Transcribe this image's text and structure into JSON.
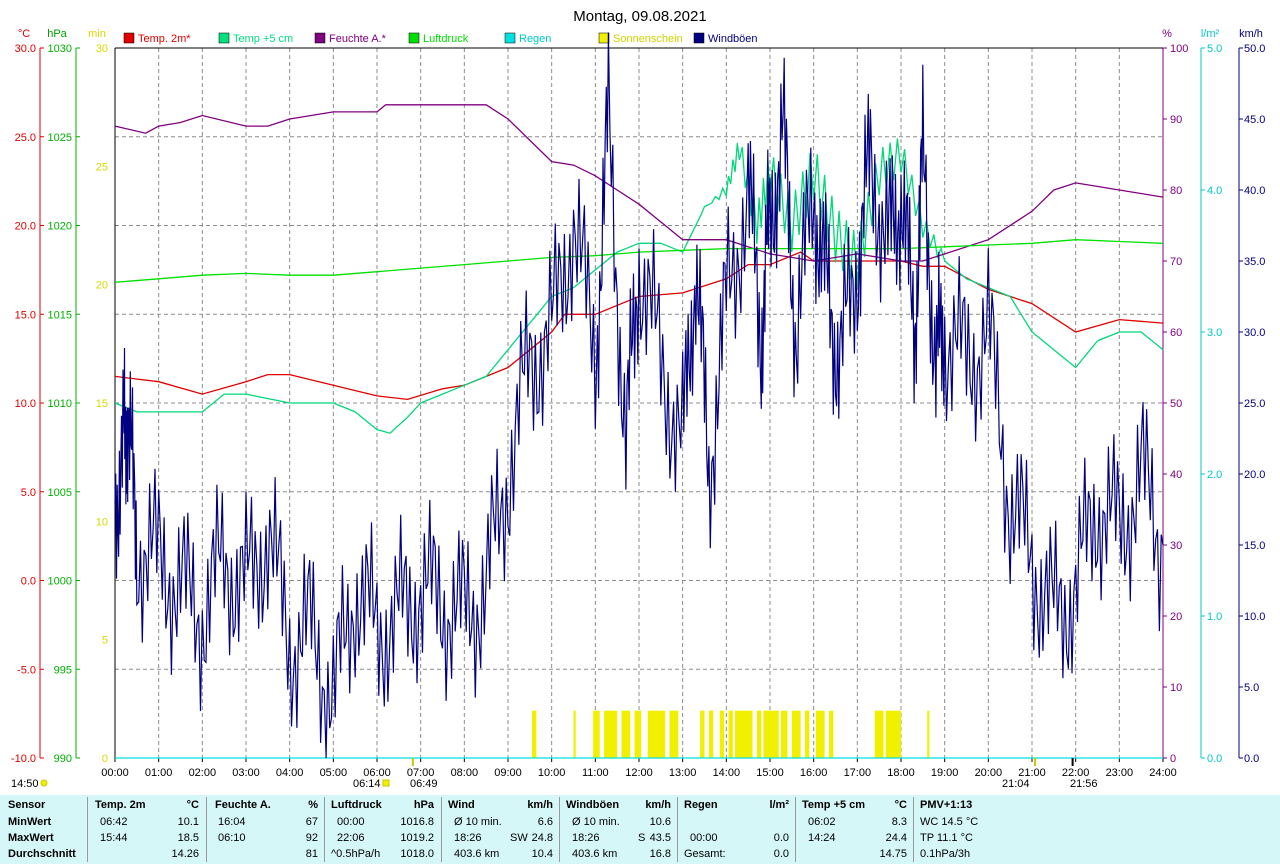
{
  "title": "Montag, 09.08.2021",
  "axes": {
    "temp": {
      "unit": "°C",
      "ticks": [
        "30.0",
        "25.0",
        "20.0",
        "15.0",
        "10.0",
        "5.0",
        "0.0",
        "-5.0",
        "-10.0"
      ]
    },
    "pressure": {
      "unit": "hPa",
      "ticks": [
        "1030",
        "1025",
        "1020",
        "1015",
        "1010",
        "1005",
        "1000",
        "995",
        "990"
      ]
    },
    "sunshine": {
      "unit": "min",
      "ticks": [
        "30",
        "25",
        "20",
        "15",
        "10",
        "5",
        "0"
      ]
    },
    "humidity": {
      "unit": "%",
      "ticks": [
        "100",
        "90",
        "80",
        "70",
        "60",
        "50",
        "40",
        "30",
        "20",
        "10",
        "0"
      ]
    },
    "rain": {
      "unit": "l/m²",
      "ticks": [
        "5.0",
        "4.0",
        "3.0",
        "2.0",
        "1.0",
        "0.0"
      ]
    },
    "wind": {
      "unit": "km/h",
      "ticks": [
        "50.0",
        "45.0",
        "40.0",
        "35.0",
        "30.0",
        "25.0",
        "20.0",
        "15.0",
        "10.0",
        "5.0",
        "0.0"
      ]
    },
    "time_ticks": [
      "00:00",
      "01:00",
      "02:00",
      "03:00",
      "04:00",
      "05:00",
      "06:00",
      "07:00",
      "08:00",
      "09:00",
      "10:00",
      "11:00",
      "12:00",
      "13:00",
      "14:00",
      "15:00",
      "16:00",
      "17:00",
      "18:00",
      "19:00",
      "20:00",
      "21:00",
      "22:00",
      "23:00",
      "24:00"
    ]
  },
  "legend": [
    {
      "label": "Temp. 2m*",
      "color": "#e00000"
    },
    {
      "label": "Temp +5 cm",
      "color": "#00e080"
    },
    {
      "label": "Feuchte A.*",
      "color": "#800080"
    },
    {
      "label": "Luftdruck",
      "color": "#00e000"
    },
    {
      "label": "Regen",
      "color": "#00e0e0"
    },
    {
      "label": "Sonnenschein",
      "color": "#f0f000"
    },
    {
      "label": "Windböen",
      "color": "#000080"
    }
  ],
  "markers": {
    "corner": "14:50",
    "sunrise": "06:14",
    "sunrise_civil": "06:49",
    "sunset_civil": "21:04",
    "sunset": "21:56"
  },
  "chart_data": {
    "type": "line",
    "title": "Montag, 09.08.2021",
    "x_range": [
      "00:00",
      "24:00"
    ],
    "series": [
      {
        "name": "Temp. 2m*",
        "axis": "°C",
        "ylim": [
          -10,
          30
        ],
        "points": [
          [
            0,
            11.5
          ],
          [
            1,
            11.2
          ],
          [
            2,
            10.5
          ],
          [
            3,
            11.2
          ],
          [
            3.5,
            11.6
          ],
          [
            4,
            11.6
          ],
          [
            5,
            11.0
          ],
          [
            6,
            10.4
          ],
          [
            6.7,
            10.2
          ],
          [
            7.5,
            10.8
          ],
          [
            8,
            11.0
          ],
          [
            9,
            12.0
          ],
          [
            10,
            14.0
          ],
          [
            10.3,
            15.0
          ],
          [
            11,
            15.0
          ],
          [
            12,
            16.0
          ],
          [
            13,
            16.2
          ],
          [
            14,
            17.0
          ],
          [
            14.5,
            17.8
          ],
          [
            15,
            17.8
          ],
          [
            15.7,
            18.5
          ],
          [
            16,
            18.0
          ],
          [
            17,
            18.0
          ],
          [
            18,
            18.0
          ],
          [
            18.5,
            17.7
          ],
          [
            19,
            17.7
          ],
          [
            20,
            16.4
          ],
          [
            21,
            15.6
          ],
          [
            22,
            14.0
          ],
          [
            23,
            14.7
          ],
          [
            24,
            14.5
          ]
        ]
      },
      {
        "name": "Temp +5 cm",
        "axis": "°C",
        "ylim": [
          -10,
          30
        ],
        "points": [
          [
            0,
            10.0
          ],
          [
            0.5,
            9.5
          ],
          [
            1,
            9.5
          ],
          [
            2,
            9.5
          ],
          [
            2.5,
            10.5
          ],
          [
            3,
            10.5
          ],
          [
            4,
            10.0
          ],
          [
            4.5,
            10.0
          ],
          [
            5,
            10.0
          ],
          [
            5.5,
            9.5
          ],
          [
            6,
            8.5
          ],
          [
            6.3,
            8.3
          ],
          [
            6.7,
            9.2
          ],
          [
            7,
            10.0
          ],
          [
            8,
            11.0
          ],
          [
            8.5,
            11.5
          ],
          [
            9,
            13.0
          ],
          [
            9.5,
            14.5
          ],
          [
            10,
            16.0
          ],
          [
            10.5,
            16.5
          ],
          [
            11,
            17.5
          ],
          [
            11.5,
            18.5
          ],
          [
            12,
            19.0
          ],
          [
            12.5,
            19.0
          ],
          [
            13,
            18.5
          ],
          [
            13.5,
            21.0
          ],
          [
            14,
            22.0
          ],
          [
            14.3,
            24.4
          ],
          [
            14.7,
            20.0
          ],
          [
            15,
            23.0
          ],
          [
            15.5,
            20.0
          ],
          [
            16,
            23.0
          ],
          [
            16.5,
            19.5
          ],
          [
            17,
            18.0
          ],
          [
            17.5,
            23.0
          ],
          [
            18,
            24.0
          ],
          [
            18.5,
            20.0
          ],
          [
            19,
            18.0
          ],
          [
            19.5,
            17.0
          ],
          [
            20,
            16.5
          ],
          [
            20.5,
            16.0
          ],
          [
            21,
            14.0
          ],
          [
            21.5,
            13.0
          ],
          [
            22,
            12.0
          ],
          [
            22.5,
            13.5
          ],
          [
            23,
            14.0
          ],
          [
            23.5,
            14.0
          ],
          [
            24,
            13.0
          ]
        ]
      },
      {
        "name": "Feuchte A.*",
        "axis": "%",
        "ylim": [
          0,
          100
        ],
        "points": [
          [
            0,
            89
          ],
          [
            0.7,
            88
          ],
          [
            1,
            89
          ],
          [
            1.5,
            89.5
          ],
          [
            2,
            90.5
          ],
          [
            3,
            89
          ],
          [
            3.5,
            89
          ],
          [
            4,
            90
          ],
          [
            5,
            91
          ],
          [
            6,
            91
          ],
          [
            6.2,
            92
          ],
          [
            7,
            92
          ],
          [
            8,
            92
          ],
          [
            8.5,
            92
          ],
          [
            9,
            90
          ],
          [
            10,
            84
          ],
          [
            10.5,
            83.5
          ],
          [
            11,
            82
          ],
          [
            12,
            78
          ],
          [
            13,
            73
          ],
          [
            14,
            73
          ],
          [
            15,
            71
          ],
          [
            16,
            70
          ],
          [
            17,
            71
          ],
          [
            18,
            70
          ],
          [
            18.5,
            70
          ],
          [
            19,
            71
          ],
          [
            20,
            73
          ],
          [
            21,
            77
          ],
          [
            21.5,
            80
          ],
          [
            22,
            81
          ],
          [
            23,
            80
          ],
          [
            24,
            79
          ]
        ]
      },
      {
        "name": "Luftdruck",
        "axis": "hPa",
        "ylim": [
          990,
          1030
        ],
        "points": [
          [
            0,
            1016.8
          ],
          [
            1,
            1017.0
          ],
          [
            2,
            1017.2
          ],
          [
            3,
            1017.3
          ],
          [
            4,
            1017.2
          ],
          [
            5,
            1017.2
          ],
          [
            6,
            1017.4
          ],
          [
            7,
            1017.6
          ],
          [
            8,
            1017.8
          ],
          [
            9,
            1018.0
          ],
          [
            10,
            1018.2
          ],
          [
            11,
            1018.3
          ],
          [
            12,
            1018.5
          ],
          [
            13,
            1018.6
          ],
          [
            14,
            1018.7
          ],
          [
            15,
            1018.7
          ],
          [
            16,
            1018.7
          ],
          [
            17,
            1018.7
          ],
          [
            18,
            1018.7
          ],
          [
            19,
            1018.8
          ],
          [
            20,
            1018.9
          ],
          [
            21,
            1019.0
          ],
          [
            22,
            1019.2
          ],
          [
            23,
            1019.1
          ],
          [
            24,
            1019.0
          ]
        ]
      },
      {
        "name": "Regen",
        "axis": "l/m²",
        "ylim": [
          0,
          5
        ],
        "points": [
          [
            0,
            0
          ],
          [
            24,
            0
          ]
        ]
      },
      {
        "name": "Windböen",
        "axis": "km/h",
        "ylim": [
          0,
          50
        ],
        "points": [
          [
            0,
            18
          ],
          [
            0.2,
            22
          ],
          [
            0.3,
            24
          ],
          [
            0.5,
            15
          ],
          [
            1,
            14
          ],
          [
            1.5,
            12
          ],
          [
            2,
            10
          ],
          [
            2.5,
            14
          ],
          [
            3,
            12
          ],
          [
            3.5,
            16
          ],
          [
            4,
            8
          ],
          [
            4.5,
            9
          ],
          [
            5,
            4
          ],
          [
            5.5,
            12
          ],
          [
            6,
            9
          ],
          [
            6.5,
            10
          ],
          [
            7,
            12
          ],
          [
            7.5,
            11
          ],
          [
            8,
            10
          ],
          [
            8.5,
            12
          ],
          [
            9,
            20
          ],
          [
            9.5,
            28
          ],
          [
            10,
            30
          ],
          [
            10.5,
            38
          ],
          [
            11,
            28
          ],
          [
            11.3,
            45
          ],
          [
            11.7,
            22
          ],
          [
            12,
            35
          ],
          [
            12.5,
            28
          ],
          [
            13,
            22
          ],
          [
            13.3,
            35
          ],
          [
            13.6,
            20
          ],
          [
            14,
            32
          ],
          [
            14.5,
            40
          ],
          [
            14.8,
            30
          ],
          [
            15,
            38
          ],
          [
            15.3,
            44
          ],
          [
            15.6,
            30
          ],
          [
            16,
            40
          ],
          [
            16.3,
            33
          ],
          [
            16.6,
            28
          ],
          [
            17,
            35
          ],
          [
            17.3,
            42
          ],
          [
            17.7,
            36
          ],
          [
            18,
            40
          ],
          [
            18.3,
            30
          ],
          [
            18.5,
            42
          ],
          [
            18.8,
            28
          ],
          [
            19,
            30
          ],
          [
            19.5,
            28
          ],
          [
            20,
            30
          ],
          [
            20.5,
            18
          ],
          [
            21,
            14
          ],
          [
            21.5,
            10
          ],
          [
            22,
            12
          ],
          [
            22.5,
            18
          ],
          [
            23,
            16
          ],
          [
            23.5,
            20
          ],
          [
            24,
            15
          ]
        ]
      },
      {
        "name": "Sonnenschein",
        "axis": "min",
        "ylim": [
          0,
          30
        ],
        "intervals": [
          [
            9.55,
            9.65
          ],
          [
            10.5,
            10.55
          ],
          [
            10.95,
            11.1
          ],
          [
            11.2,
            11.5
          ],
          [
            11.6,
            11.8
          ],
          [
            11.9,
            12.05
          ],
          [
            12.2,
            12.6
          ],
          [
            12.7,
            12.9
          ],
          [
            13.4,
            13.5
          ],
          [
            13.6,
            13.7
          ],
          [
            13.85,
            13.95
          ],
          [
            14.05,
            14.15
          ],
          [
            14.2,
            14.6
          ],
          [
            14.7,
            14.8
          ],
          [
            14.85,
            15.2
          ],
          [
            15.25,
            15.4
          ],
          [
            15.5,
            15.7
          ],
          [
            15.8,
            15.9
          ],
          [
            16.05,
            16.25
          ],
          [
            16.35,
            16.45
          ],
          [
            17.4,
            17.6
          ],
          [
            17.65,
            18.0
          ],
          [
            18.6,
            18.65
          ]
        ],
        "value": 2
      }
    ]
  },
  "stats": {
    "headers": {
      "sensor": "Sensor",
      "temp2m": "Temp. 2m",
      "temp2m_unit": "°C",
      "hum": "Feuchte A.",
      "hum_unit": "%",
      "press": "Luftdruck",
      "press_unit": "hPa",
      "wind": "Wind",
      "wind_unit": "km/h",
      "gust": "Windböen",
      "gust_unit": "km/h",
      "rain": "Regen",
      "rain_unit": "l/m²",
      "temp5": "Temp +5 cm",
      "temp5_unit": "°C",
      "pmv": "PMV+1:13"
    },
    "rows": [
      "MinWert",
      "MaxWert",
      "Durchschnitt"
    ],
    "temp2m": [
      [
        "06:42",
        "10.1"
      ],
      [
        "15:44",
        "18.5"
      ],
      [
        "",
        "14.26"
      ]
    ],
    "hum": [
      [
        "16:04",
        "67"
      ],
      [
        "06:10",
        "92"
      ],
      [
        "",
        "81"
      ]
    ],
    "press": [
      [
        "00:00",
        "1016.8"
      ],
      [
        "22:06",
        "1019.2"
      ],
      [
        "^0.5hPa/h",
        "1018.0"
      ]
    ],
    "wind": [
      [
        "Ø 10 min.",
        "",
        "6.6"
      ],
      [
        "18:26",
        "SW",
        "24.8"
      ],
      [
        "403.6 km",
        "",
        "10.4"
      ]
    ],
    "gust": [
      [
        "Ø 10 min.",
        "",
        "10.6"
      ],
      [
        "18:26",
        "S",
        "43.5"
      ],
      [
        "403.6 km",
        "",
        "16.8"
      ]
    ],
    "rain": [
      [
        "",
        ""
      ],
      [
        "00:00",
        "0.0"
      ],
      [
        "Gesamt:",
        "0.0"
      ]
    ],
    "temp5": [
      [
        "06:02",
        "8.3"
      ],
      [
        "14:24",
        "24.4"
      ],
      [
        "",
        "14.75"
      ]
    ],
    "pmv": [
      "WC 14.5 °C",
      "TP 11.1 °C",
      "0.1hPa/3h"
    ]
  }
}
